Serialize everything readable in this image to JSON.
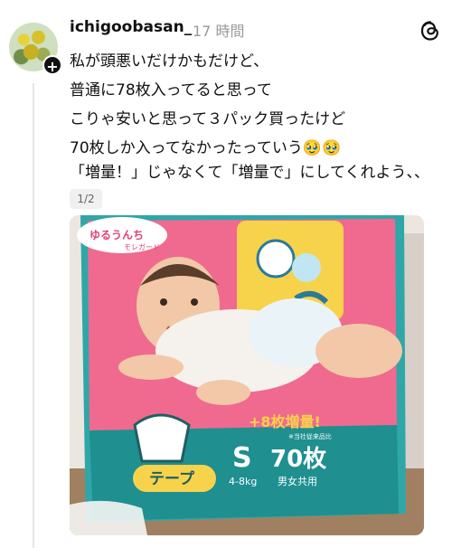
{
  "post": {
    "username": "ichigoobasan_",
    "time": "17 時間",
    "lines": [
      "私が頭悪いだけかもだけど、",
      "普通に78枚入ってると思って",
      "こりゃ安いと思って３パック買ったけど",
      "70枚しか入ってなかったっていう🥹🥹"
    ],
    "second_line": "「増量！」じゃなくて「増量で」にしてくれよう、、",
    "page_indicator": "1/2"
  },
  "photo": {
    "package": {
      "badge_text": "ゆるうんち",
      "badge_sub": "モレガード",
      "bonus": "+8枚増量!",
      "bonus_note": "※当社従来品比",
      "size": "S",
      "count": "70枚",
      "weight": "4-8kg",
      "unisex": "男女共用",
      "type": "テープ"
    }
  },
  "icons": {
    "threads": "threads-logo-icon",
    "follow": "plus-icon"
  }
}
